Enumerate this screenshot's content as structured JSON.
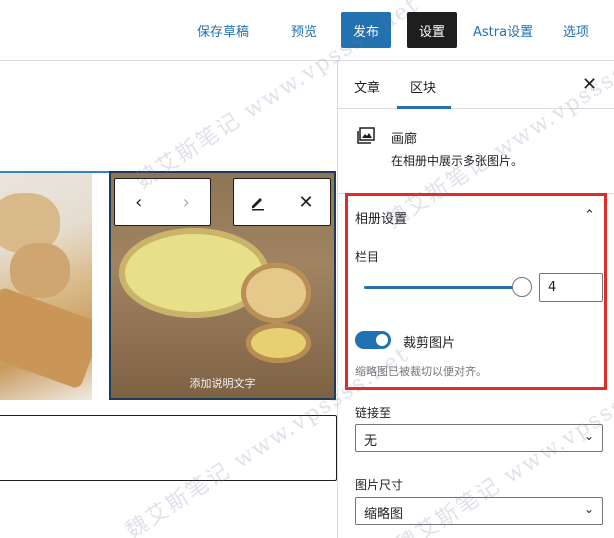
{
  "header": {
    "save_draft": "保存草稿",
    "preview": "预览",
    "publish": "发布",
    "settings": "设置",
    "astra_settings": "Astra设置",
    "options": "选项"
  },
  "canvas": {
    "caption_placeholder": "添加说明文字",
    "nav_prev_icon": "chevron-left",
    "nav_next_icon": "chevron-right",
    "edit_icon": "pencil",
    "remove_icon": "close"
  },
  "sidebar": {
    "tabs": [
      {
        "label": "文章"
      },
      {
        "label": "区块"
      }
    ],
    "active_tab": "区块",
    "block": {
      "title": "画廊",
      "description": "在相册中展示多张图片。"
    },
    "gallery_settings": {
      "title": "相册设置",
      "columns_label": "栏目",
      "columns_value": "4",
      "columns_max": "8",
      "crop_label": "裁剪图片",
      "crop_enabled": true,
      "crop_help": "缩略图已被裁切以便对齐。"
    },
    "link_to": {
      "label": "链接至",
      "value": "无"
    },
    "image_size": {
      "label": "图片尺寸",
      "value": "缩略图"
    }
  },
  "watermark": {
    "text": "魏艾斯笔记 www.vpssss.net"
  },
  "colors": {
    "accent": "#2271b1",
    "button_dark": "#1e1e1e",
    "highlight_border": "#e02b27"
  }
}
